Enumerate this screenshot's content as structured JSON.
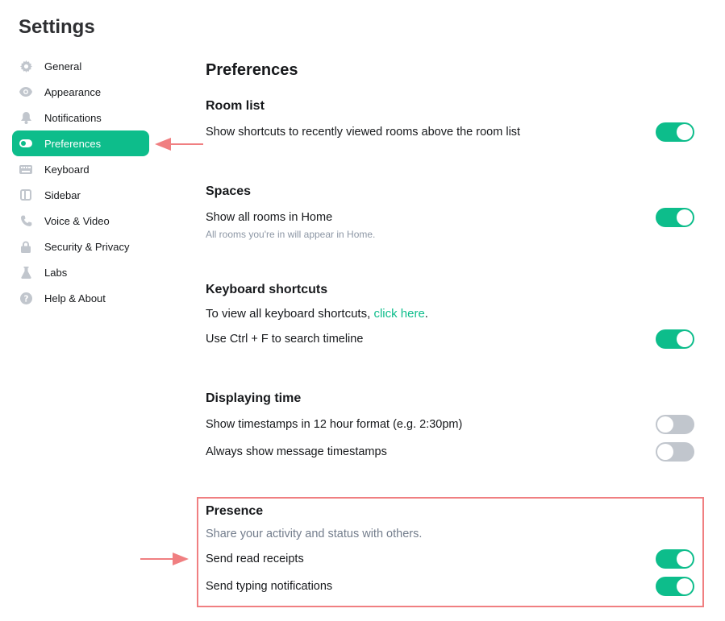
{
  "app": {
    "title": "Settings"
  },
  "sidebar": {
    "items": [
      {
        "label": "General",
        "icon": "gear-icon",
        "active": false
      },
      {
        "label": "Appearance",
        "icon": "eye-icon",
        "active": false
      },
      {
        "label": "Notifications",
        "icon": "bell-icon",
        "active": false
      },
      {
        "label": "Preferences",
        "icon": "toggle-icon",
        "active": true
      },
      {
        "label": "Keyboard",
        "icon": "keyboard-icon",
        "active": false
      },
      {
        "label": "Sidebar",
        "icon": "sidebar-icon",
        "active": false
      },
      {
        "label": "Voice & Video",
        "icon": "phone-icon",
        "active": false
      },
      {
        "label": "Security & Privacy",
        "icon": "lock-icon",
        "active": false
      },
      {
        "label": "Labs",
        "icon": "flask-icon",
        "active": false
      },
      {
        "label": "Help & About",
        "icon": "help-icon",
        "active": false
      }
    ]
  },
  "main": {
    "title": "Preferences",
    "room_list": {
      "title": "Room list",
      "show_shortcuts": {
        "label": "Show shortcuts to recently viewed rooms above the room list",
        "enabled": true
      }
    },
    "spaces": {
      "title": "Spaces",
      "show_all_rooms": {
        "label": "Show all rooms in Home",
        "description": "All rooms you're in will appear in Home.",
        "enabled": true
      }
    },
    "keyboard_shortcuts": {
      "title": "Keyboard shortcuts",
      "view_all_prefix": "To view all keyboard shortcuts, ",
      "view_all_link": "click here",
      "view_all_suffix": ".",
      "ctrl_f": {
        "label": "Use Ctrl + F to search timeline",
        "enabled": true
      }
    },
    "displaying_time": {
      "title": "Displaying time",
      "twelve_hour": {
        "label": "Show timestamps in 12 hour format (e.g. 2:30pm)",
        "enabled": false
      },
      "always_show": {
        "label": "Always show message timestamps",
        "enabled": false
      }
    },
    "presence": {
      "title": "Presence",
      "description": "Share your activity and status with others.",
      "read_receipts": {
        "label": "Send read receipts",
        "enabled": true
      },
      "typing_notifications": {
        "label": "Send typing notifications",
        "enabled": true
      }
    }
  },
  "colors": {
    "accent": "#0dbd8b",
    "toggle_off": "#c1c6cd",
    "annotation": "#f07f81",
    "icon_gray": "#c1c6cd"
  }
}
